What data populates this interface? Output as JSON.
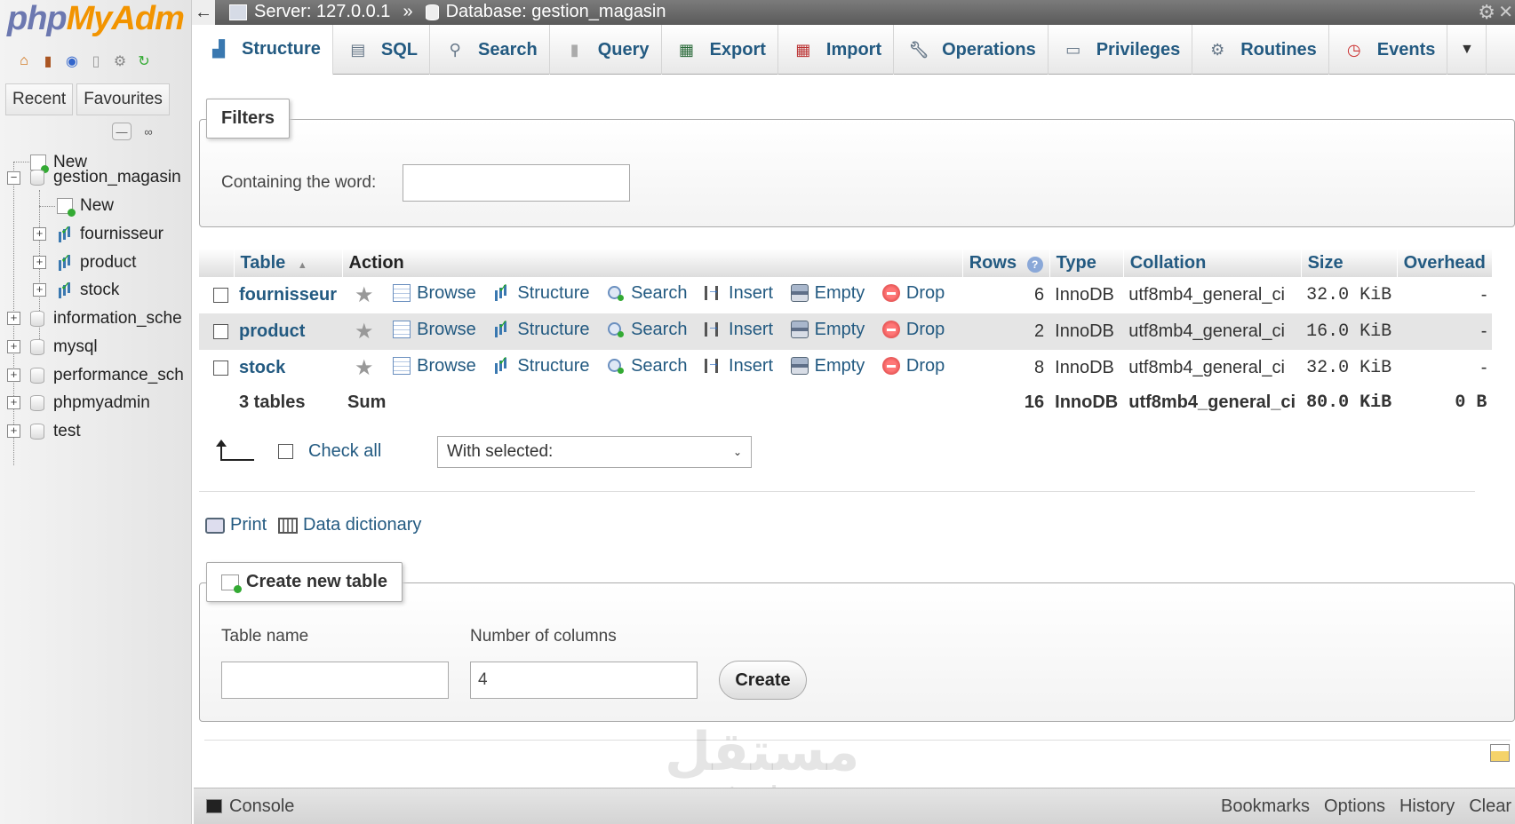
{
  "logo": {
    "part1": "php",
    "part2": "MyAdm"
  },
  "sidebar": {
    "tabs": [
      "Recent",
      "Favourites"
    ],
    "tree": [
      {
        "label": "New"
      },
      {
        "label": "gestion_magasin"
      },
      {
        "label": "New"
      },
      {
        "label": "fournisseur"
      },
      {
        "label": "product"
      },
      {
        "label": "stock"
      },
      {
        "label": "information_sche"
      },
      {
        "label": "mysql"
      },
      {
        "label": "performance_sch"
      },
      {
        "label": "phpmyadmin"
      },
      {
        "label": "test"
      }
    ]
  },
  "breadcrumb": {
    "server": "Server: 127.0.0.1",
    "separator": "»",
    "database": "Database: gestion_magasin"
  },
  "tabs": [
    "Structure",
    "SQL",
    "Search",
    "Query",
    "Export",
    "Import",
    "Operations",
    "Privileges",
    "Routines",
    "Events"
  ],
  "filters": {
    "legend": "Filters",
    "label": "Containing the word:",
    "value": ""
  },
  "table": {
    "headers": {
      "table": "Table",
      "action": "Action",
      "rows": "Rows",
      "type": "Type",
      "collation": "Collation",
      "size": "Size",
      "overhead": "Overhead"
    },
    "sort_indicator": "▲",
    "actions": [
      "Browse",
      "Structure",
      "Search",
      "Insert",
      "Empty",
      "Drop"
    ],
    "rows": [
      {
        "name": "fournisseur",
        "rows": "6",
        "type": "InnoDB",
        "collation": "utf8mb4_general_ci",
        "size": "32.0 KiB",
        "overhead": "-"
      },
      {
        "name": "product",
        "rows": "2",
        "type": "InnoDB",
        "collation": "utf8mb4_general_ci",
        "size": "16.0 KiB",
        "overhead": "-"
      },
      {
        "name": "stock",
        "rows": "8",
        "type": "InnoDB",
        "collation": "utf8mb4_general_ci",
        "size": "32.0 KiB",
        "overhead": "-"
      }
    ],
    "summary": {
      "count": "3 tables",
      "label": "Sum",
      "rows": "16",
      "type": "InnoDB",
      "collation": "utf8mb4_general_ci",
      "size": "80.0 KiB",
      "overhead": "0 B"
    }
  },
  "bulk": {
    "check_all": "Check all",
    "with_selected": "With selected:"
  },
  "links": {
    "print": "Print",
    "data_dictionary": "Data dictionary"
  },
  "create_table": {
    "legend": "Create new table",
    "name_label": "Table name",
    "name_value": "",
    "columns_label": "Number of columns",
    "columns_value": "4",
    "button": "Create"
  },
  "console": {
    "label": "Console",
    "links": [
      "Bookmarks",
      "Options",
      "History",
      "Clear"
    ]
  },
  "watermark": {
    "arabic": "مستقل",
    "latin": "mostaql.com"
  }
}
